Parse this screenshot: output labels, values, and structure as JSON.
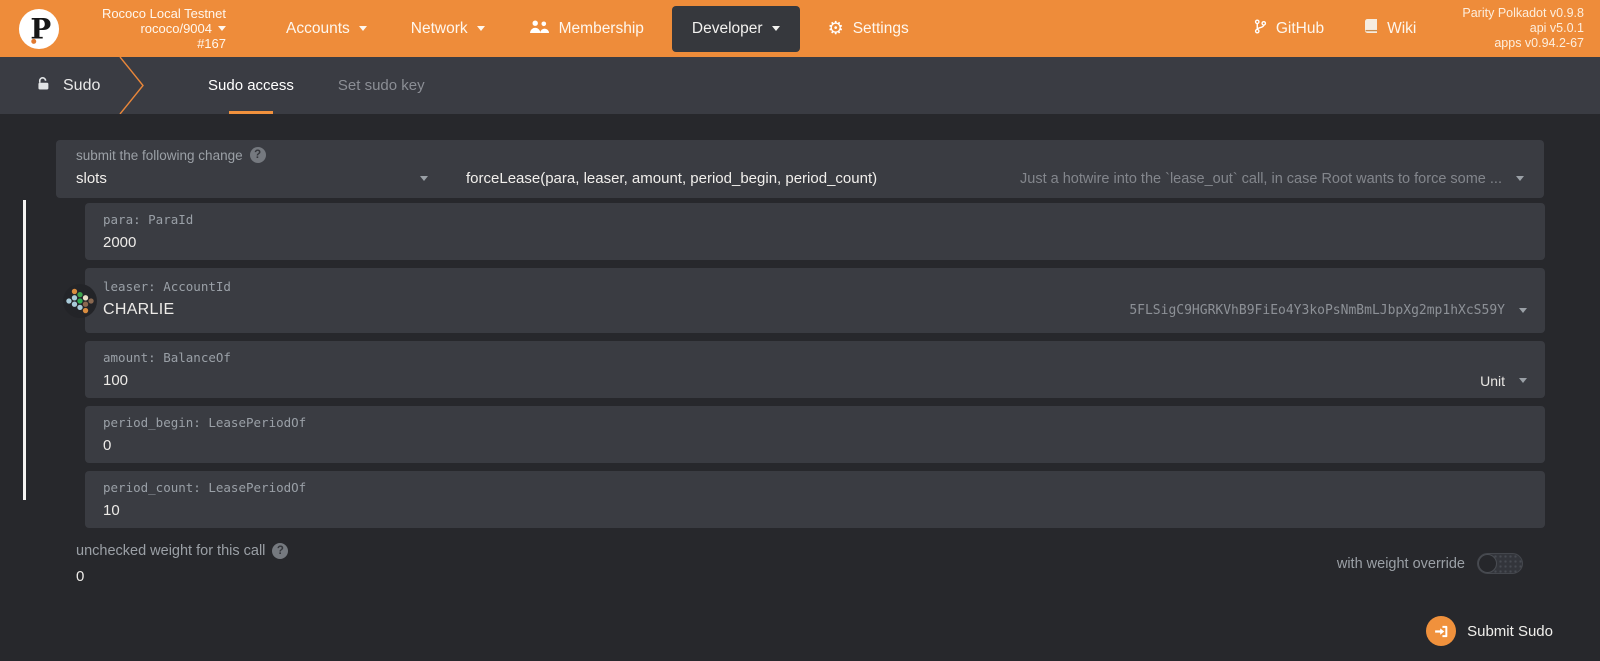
{
  "header": {
    "chain_name": "Rococo Local Testnet",
    "chain_spec": "rococo/9004",
    "block_number": "#167",
    "nav": {
      "accounts": "Accounts",
      "network": "Network",
      "membership": "Membership",
      "developer": "Developer",
      "settings": "Settings"
    },
    "links": {
      "github": "GitHub",
      "wiki": "Wiki"
    },
    "versions": {
      "node": "Parity Polkadot v0.9.8",
      "api": "api v5.0.1",
      "apps": "apps v0.94.2-67"
    }
  },
  "tabbar": {
    "app_name": "Sudo",
    "tab_access": "Sudo access",
    "tab_setkey": "Set sudo key"
  },
  "form": {
    "section_label": "submit the following change",
    "pallet_selected": "slots",
    "method_selected": "forceLease(para, leaser, amount, period_begin, period_count)",
    "method_docs": "Just a hotwire into the `lease_out` call, in case Root wants to force some ...",
    "params": [
      {
        "label": "para: ParaId",
        "value": "2000"
      },
      {
        "label": "leaser: AccountId",
        "value": "CHARLIE",
        "address": "5FLSigC9HGRKVhB9FiEo4Y3koPsNmBmLJbpXg2mp1hXcS59Y"
      },
      {
        "label": "amount: BalanceOf",
        "value": "100",
        "unit": "Unit"
      },
      {
        "label": "period_begin: LeasePeriodOf",
        "value": "0"
      },
      {
        "label": "period_count: LeasePeriodOf",
        "value": "10"
      }
    ],
    "weight": {
      "label": "unchecked weight for this call",
      "value": "0"
    },
    "weight_override": {
      "label": "with weight override",
      "enabled": false
    },
    "submit": {
      "label": "Submit Sudo"
    }
  },
  "colors": {
    "accent_orange": "#ee8c3a",
    "tab_underline": "#f1913d",
    "page_bg": "#27282c",
    "panel_bg": "#3a3c42",
    "tabbar_bg": "#3a3c43"
  }
}
